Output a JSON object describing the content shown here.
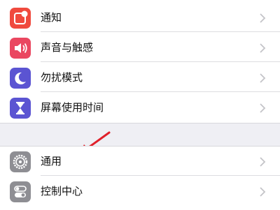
{
  "settings_group_1": {
    "items": [
      {
        "label": "通知",
        "icon": "notifications-icon",
        "color": "#f04a3e"
      },
      {
        "label": "声音与触感",
        "icon": "sounds-haptics-icon",
        "color": "#ea4760"
      },
      {
        "label": "勿扰模式",
        "icon": "do-not-disturb-moon-icon",
        "color": "#5b54d2"
      },
      {
        "label": "屏幕使用时间",
        "icon": "screen-time-hourglass-icon",
        "color": "#5b54d2"
      }
    ]
  },
  "settings_group_2": {
    "items": [
      {
        "label": "通用",
        "icon": "general-gear-icon",
        "color": "#8e8e93"
      },
      {
        "label": "控制中心",
        "icon": "control-center-toggles-icon",
        "color": "#8e8e93"
      }
    ]
  },
  "annotation": {
    "icon": "red-arrow-pointer",
    "color": "#e0202a"
  }
}
